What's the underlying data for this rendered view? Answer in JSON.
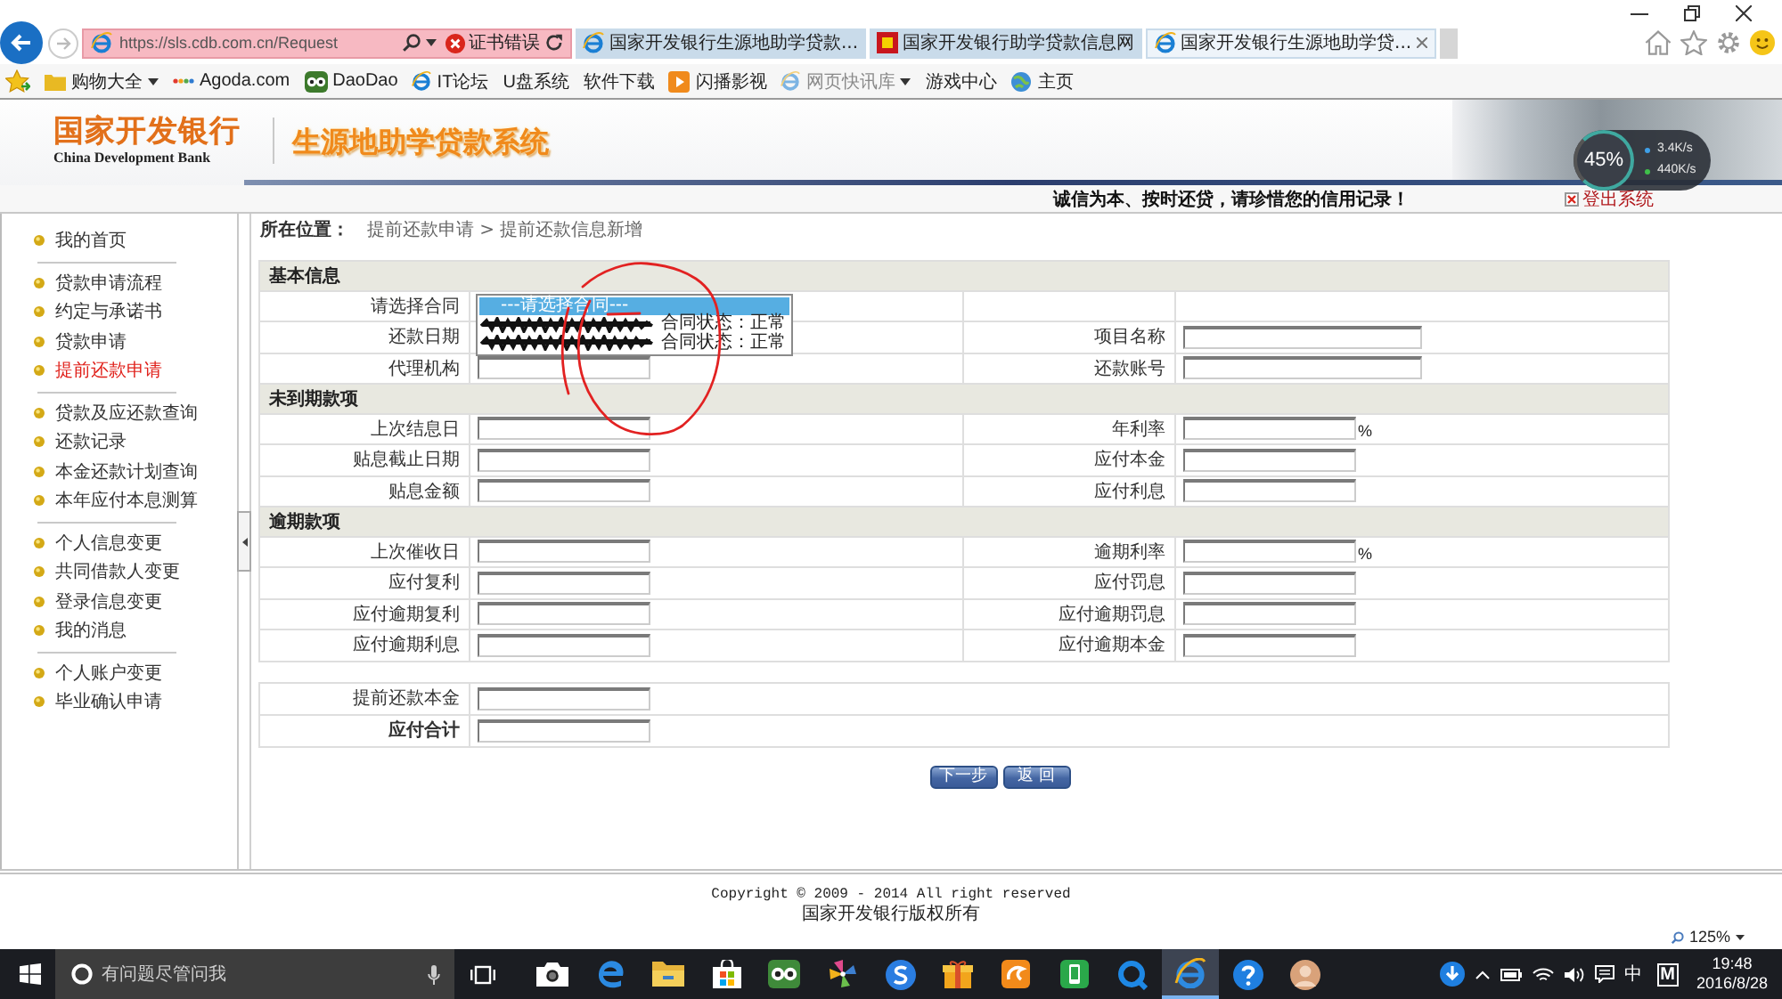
{
  "browser": {
    "address": "https://sls.cdb.com.cn/Request",
    "cert_error": "证书错误",
    "tabs": [
      {
        "title": "国家开发银行生源地助学贷款...",
        "selected": false
      },
      {
        "title": "国家开发银行助学贷款信息网",
        "selected": false
      },
      {
        "title": "国家开发银行生源地助学贷...",
        "selected": true
      }
    ],
    "favorites": [
      {
        "label": "购物大全",
        "dropdown": true,
        "disabled": false
      },
      {
        "label": "Agoda.com",
        "dropdown": false,
        "disabled": false
      },
      {
        "label": "DaoDao",
        "dropdown": false,
        "disabled": false
      },
      {
        "label": "IT论坛",
        "dropdown": false,
        "disabled": false
      },
      {
        "label": "U盘系统",
        "dropdown": false,
        "disabled": false
      },
      {
        "label": "软件下载",
        "dropdown": false,
        "disabled": false
      },
      {
        "label": "闪播影视",
        "dropdown": false,
        "disabled": false
      },
      {
        "label": "网页快讯库",
        "dropdown": true,
        "disabled": true
      },
      {
        "label": "游戏中心",
        "dropdown": false,
        "disabled": false
      },
      {
        "label": "主页",
        "dropdown": false,
        "disabled": false
      }
    ],
    "zoom": "125%"
  },
  "header": {
    "bank_name": "国家开发银行",
    "bank_name_en": "China Development Bank",
    "system_title": "生源地助学贷款系统",
    "slogan": "诚信为本、按时还贷，请珍惜您的信用记录！",
    "logout": "登出系统"
  },
  "speed_widget": {
    "percent": "45%",
    "upload": "3.4K/s",
    "download": "440K/s"
  },
  "sidebar": {
    "groups": [
      {
        "items": [
          {
            "label": "我的首页",
            "selected": false
          }
        ]
      },
      {
        "items": [
          {
            "label": "贷款申请流程",
            "selected": false
          },
          {
            "label": "约定与承诺书",
            "selected": false
          },
          {
            "label": "贷款申请",
            "selected": false
          },
          {
            "label": "提前还款申请",
            "selected": true
          }
        ]
      },
      {
        "items": [
          {
            "label": "贷款及应还款查询",
            "selected": false
          },
          {
            "label": "还款记录",
            "selected": false
          },
          {
            "label": "本金还款计划查询",
            "selected": false
          },
          {
            "label": "本年应付本息测算",
            "selected": false
          }
        ]
      },
      {
        "items": [
          {
            "label": "个人信息变更",
            "selected": false
          },
          {
            "label": "共同借款人变更",
            "selected": false
          },
          {
            "label": "登录信息变更",
            "selected": false
          },
          {
            "label": "我的消息",
            "selected": false
          }
        ]
      },
      {
        "items": [
          {
            "label": "个人账户变更",
            "selected": false
          },
          {
            "label": "毕业确认申请",
            "selected": false
          }
        ]
      }
    ]
  },
  "breadcrumb": {
    "label": "所在位置：",
    "path": "提前还款申请 > 提前还款信息新增"
  },
  "form": {
    "sections": [
      {
        "title": "基本信息",
        "rows": [
          {
            "left": {
              "label": "请选择合同",
              "kind": "select",
              "options": [
                {
                  "label": "---请选择合同---",
                  "selected": true,
                  "redacted": false
                },
                {
                  "label": "合同状态：正常",
                  "selected": false,
                  "redacted": true
                },
                {
                  "label": "合同状态：正常",
                  "selected": false,
                  "redacted": true
                }
              ]
            }
          },
          {
            "left": {
              "label": "还款日期",
              "kind": "label"
            },
            "right": {
              "label": "项目名称",
              "kind": "input-wide"
            }
          },
          {
            "left": {
              "label": "代理机构",
              "kind": "input"
            },
            "right": {
              "label": "还款账号",
              "kind": "input-wide"
            }
          }
        ]
      },
      {
        "title": "未到期款项",
        "rows": [
          {
            "left": {
              "label": "上次结息日",
              "kind": "input"
            },
            "right": {
              "label": "年利率",
              "kind": "input",
              "suffix": "%"
            }
          },
          {
            "left": {
              "label": "贴息截止日期",
              "kind": "input"
            },
            "right": {
              "label": "应付本金",
              "kind": "input"
            }
          },
          {
            "left": {
              "label": "贴息金额",
              "kind": "input"
            },
            "right": {
              "label": "应付利息",
              "kind": "input"
            }
          }
        ]
      },
      {
        "title": "逾期款项",
        "rows": [
          {
            "left": {
              "label": "上次催收日",
              "kind": "input"
            },
            "right": {
              "label": "逾期利率",
              "kind": "input",
              "suffix": "%"
            }
          },
          {
            "left": {
              "label": "应付复利",
              "kind": "input"
            },
            "right": {
              "label": "应付罚息",
              "kind": "input"
            }
          },
          {
            "left": {
              "label": "应付逾期复利",
              "kind": "input"
            },
            "right": {
              "label": "应付逾期罚息",
              "kind": "input"
            }
          },
          {
            "left": {
              "label": "应付逾期利息",
              "kind": "input"
            },
            "right": {
              "label": "应付逾期本金",
              "kind": "input"
            }
          }
        ]
      }
    ],
    "totals": [
      {
        "label": "提前还款本金",
        "bold": false
      },
      {
        "label": "应付合计",
        "bold": true
      }
    ],
    "buttons": [
      "下一步",
      "返 回"
    ]
  },
  "footer": {
    "copyright": "Copyright © 2009 - 2014 All right reserved",
    "owner": "国家开发银行版权所有"
  },
  "taskbar": {
    "search": {
      "placeholder": "有问题尽管问我"
    },
    "apps": [
      {
        "selected": false
      },
      {
        "selected": false
      },
      {
        "selected": false
      },
      {
        "selected": false
      },
      {
        "selected": false
      },
      {
        "selected": false
      },
      {
        "selected": false
      },
      {
        "selected": false
      },
      {
        "selected": false
      },
      {
        "selected": false
      },
      {
        "selected": false
      },
      {
        "selected": true
      },
      {
        "selected": false
      },
      {
        "selected": false
      }
    ],
    "ime": "中",
    "ime_mode": "M",
    "time": "19:48",
    "date": "2016/8/28"
  }
}
